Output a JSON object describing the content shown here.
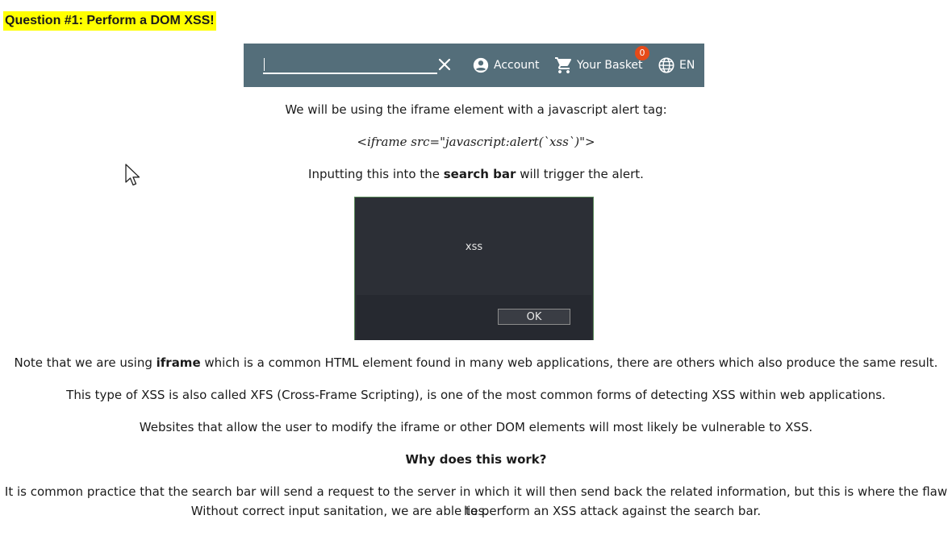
{
  "question": {
    "title": "Question #1: Perform a DOM XSS!"
  },
  "toolbar": {
    "search_value": "",
    "account_label": "Account",
    "basket_label": "Your Basket",
    "basket_count": "0",
    "language_label": "EN",
    "background_color": "#546e7a",
    "badge_color": "#e64a19"
  },
  "content": {
    "intro": "We will be using the iframe element with a javascript alert tag:",
    "code": "<iframe src=\"javascript:alert(`xss`)\">",
    "trigger_pre": "Inputting this into the ",
    "trigger_bold": "search bar",
    "trigger_post": " will trigger the alert.",
    "note_pre": "Note that we are using ",
    "note_bold": "iframe",
    "note_post": " which is a common HTML element found in many web applications, there are others which also produce the same result.",
    "xfs": "This type of XSS is also called XFS (Cross-Frame Scripting), is one of the most common forms of detecting XSS within web applications.",
    "websites": "Websites that allow the user to modify the iframe or other DOM elements will most likely be vulnerable to XSS.",
    "why_heading": "Why does this work?",
    "explanation_line1": "It is common practice that the search bar will send a request to the server in which it will then send back the related information, but this is where the flaw lies.",
    "explanation_line2": "Without correct input sanitation, we are able to perform an XSS attack against the search bar."
  },
  "dialog": {
    "message": "xss",
    "ok_label": "OK"
  }
}
